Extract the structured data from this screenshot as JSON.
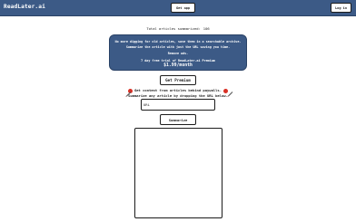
{
  "header": {
    "logo": "ReadLater.ai",
    "get_app_label": "Get app",
    "login_label": "Log in"
  },
  "stats": {
    "label": "Total articles summarized:",
    "count": "106"
  },
  "promo": {
    "line1": "No more digging for old articles, save them in a searchable archive.",
    "line2": "Summarize the article with just the URL saving you time.",
    "line3": "Remove ads.",
    "line4": "7 day free trial of ReadLater.ai Premium",
    "price": "$1.99/month"
  },
  "premium_button_label": "Get Premium",
  "paywall_text": "Get content from articles behind paywalls.",
  "instruction_text": "Summarize any article by dropping the URL below.",
  "url_input": {
    "placeholder": "URL",
    "value": ""
  },
  "summarize_button_label": "Summarize",
  "summary_output": "",
  "colors": {
    "header_bg": "#3c5a86",
    "promo_bg": "#3c5a86",
    "dot_red": "#d93025"
  },
  "icons": [
    "red-dot-icon",
    "pencil-icon"
  ]
}
